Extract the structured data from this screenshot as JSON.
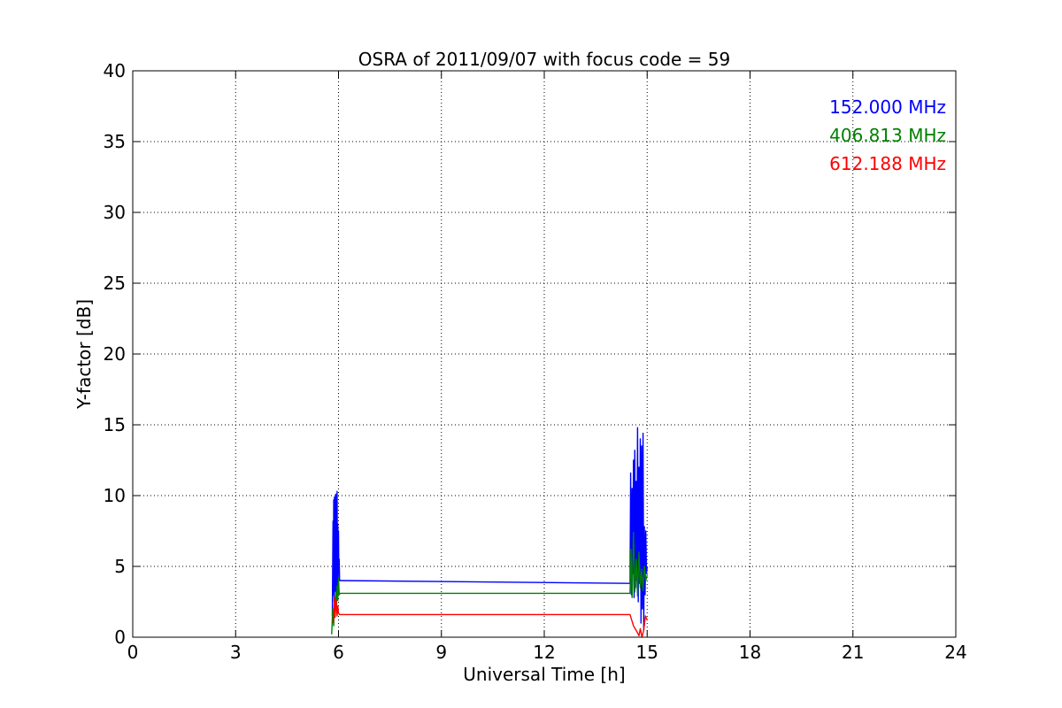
{
  "chart_data": {
    "type": "line",
    "title": "OSRA of 2011/09/07 with focus code = 59",
    "xlabel": "Universal Time [h]",
    "ylabel": "Y-factor [dB]",
    "xlim": [
      0,
      24
    ],
    "ylim": [
      0,
      40
    ],
    "xticks": [
      "0",
      "3",
      "6",
      "9",
      "12",
      "15",
      "18",
      "21",
      "24"
    ],
    "yticks": [
      "0",
      "5",
      "10",
      "15",
      "20",
      "25",
      "30",
      "35",
      "40"
    ],
    "grid": true,
    "legend_placement": "top-right",
    "series": [
      {
        "name": "152.000 MHz",
        "color": "#0000ff",
        "x": [
          5.82,
          5.84,
          5.85,
          5.86,
          5.87,
          5.88,
          5.89,
          5.9,
          5.91,
          5.92,
          5.93,
          5.94,
          5.95,
          5.96,
          5.97,
          5.98,
          5.99,
          6.0,
          6.01,
          6.02,
          6.03,
          6.05,
          14.5,
          14.52,
          14.54,
          14.56,
          14.58,
          14.6,
          14.62,
          14.64,
          14.66,
          14.68,
          14.7,
          14.72,
          14.74,
          14.76,
          14.78,
          14.8,
          14.82,
          14.84,
          14.86,
          14.88,
          14.9,
          14.92,
          14.94,
          14.96,
          14.98,
          15.0
        ],
        "y": [
          1.5,
          8.2,
          3.0,
          9.7,
          2.5,
          9.9,
          4.0,
          9.0,
          3.2,
          10.1,
          2.8,
          9.5,
          4.1,
          10.3,
          3.5,
          8.0,
          4.5,
          7.5,
          4.2,
          5.5,
          4.0,
          4.0,
          3.8,
          11.6,
          3.0,
          10.5,
          4.5,
          12.5,
          2.8,
          13.2,
          3.5,
          11.0,
          4.0,
          14.8,
          2.5,
          12.0,
          3.8,
          14.0,
          1.0,
          13.5,
          2.0,
          14.4,
          0.5,
          7.8,
          3.0,
          7.5,
          4.5,
          5.0
        ]
      },
      {
        "name": "406.813 MHz",
        "color": "#008000",
        "x": [
          5.8,
          5.83,
          5.86,
          5.88,
          5.9,
          5.92,
          5.94,
          5.96,
          5.98,
          6.0,
          6.02,
          6.05,
          14.5,
          14.53,
          14.56,
          14.6,
          14.64,
          14.68,
          14.72,
          14.76,
          14.8,
          14.84,
          14.88,
          14.92,
          14.96,
          15.0
        ],
        "y": [
          0.2,
          2.0,
          0.8,
          2.8,
          1.5,
          3.2,
          2.0,
          3.6,
          2.6,
          4.2,
          3.0,
          3.1,
          3.1,
          6.2,
          2.8,
          7.4,
          3.2,
          5.5,
          2.9,
          6.0,
          3.5,
          4.8,
          3.3,
          5.0,
          4.0,
          4.4
        ]
      },
      {
        "name": "612.188 MHz",
        "color": "#ff0000",
        "x": [
          5.85,
          5.88,
          5.9,
          5.93,
          5.96,
          5.98,
          6.0,
          6.03,
          6.05,
          14.5,
          14.6,
          14.7,
          14.76,
          14.8,
          14.85,
          14.9,
          14.95,
          15.0
        ],
        "y": [
          1.0,
          2.8,
          1.4,
          2.6,
          1.5,
          2.2,
          1.7,
          1.6,
          1.6,
          1.6,
          0.8,
          0.4,
          0.1,
          0.6,
          0.0,
          0.5,
          1.5,
          1.2
        ]
      }
    ]
  }
}
